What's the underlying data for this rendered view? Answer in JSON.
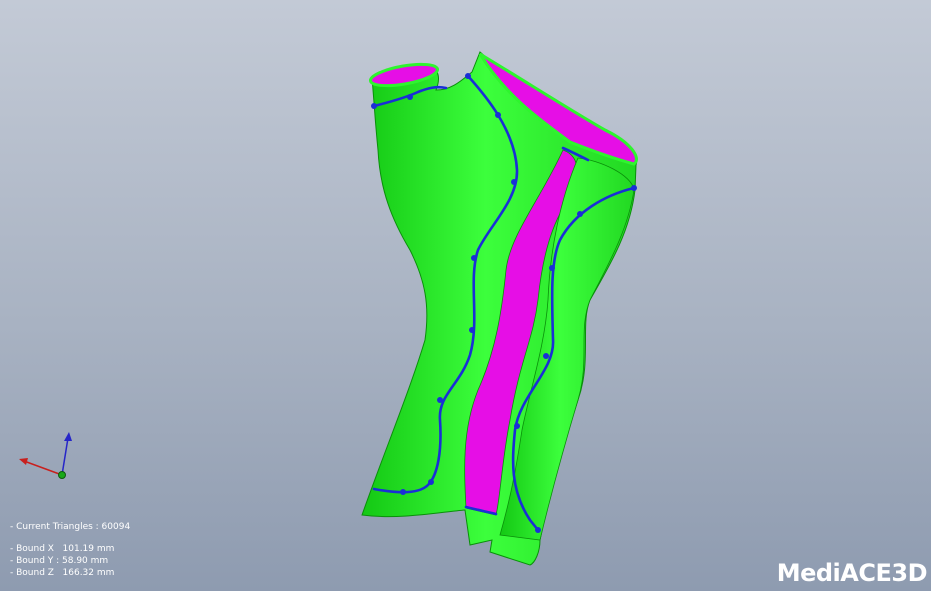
{
  "viewport": {
    "background_top": "#c3cad6",
    "background_bottom": "#8e9bb0",
    "model_color": "#2ef52e",
    "inner_surface_color": "#e60ee6",
    "curve_color": "#1a2fd6",
    "axis_colors": {
      "x": "#c8201e",
      "y": "#2626c8",
      "z": "#18a818"
    }
  },
  "stats": {
    "triangles": "- Current Triangles : 60094",
    "bound_x": "- Bound X   101.19 mm",
    "bound_y": "- Bound Y : 58.90 mm",
    "bound_z": "- Bound Z   166.32 mm"
  },
  "brand": {
    "logo_text": "MediACE3D"
  }
}
